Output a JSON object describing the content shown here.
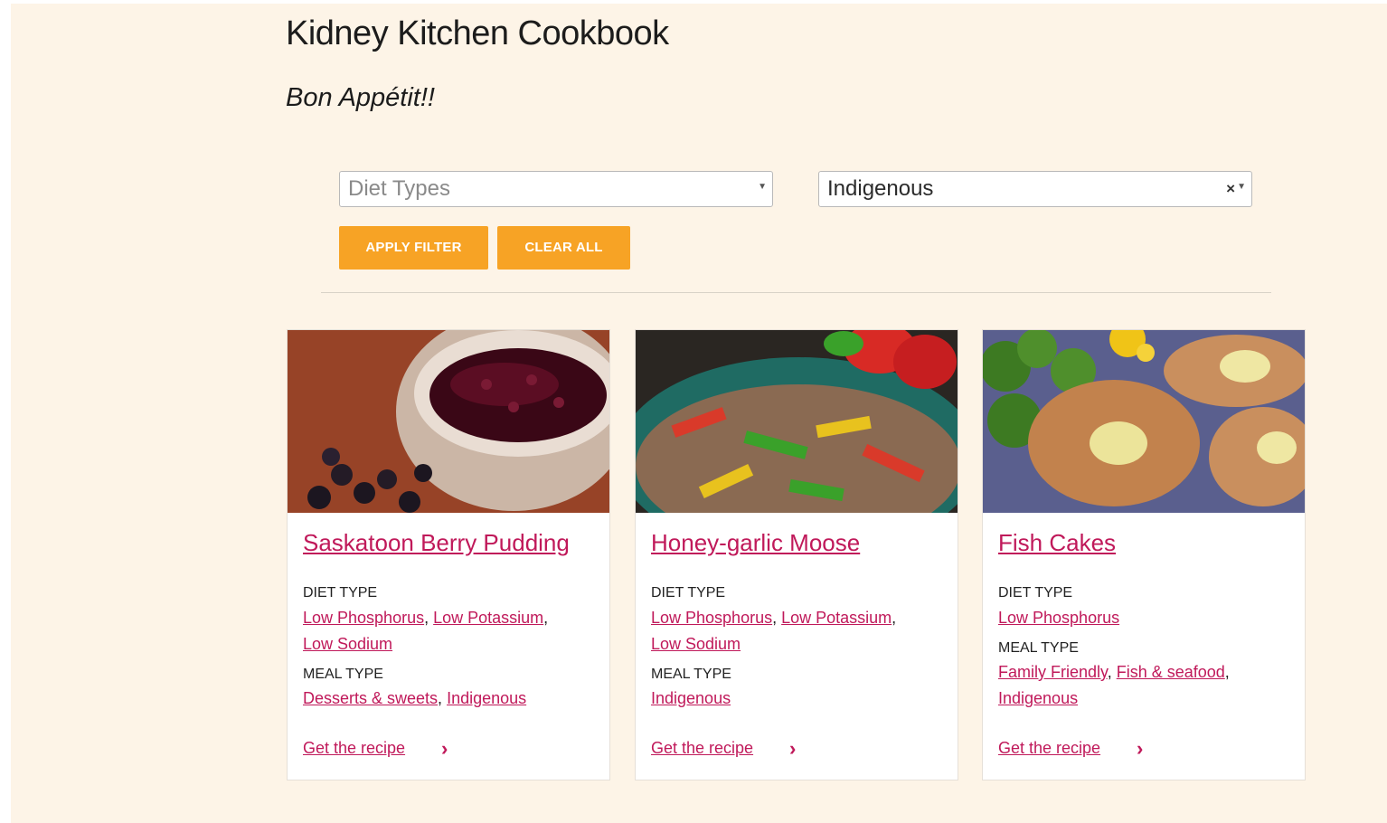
{
  "page": {
    "title": "Kidney Kitchen Cookbook",
    "subtitle": "Bon Appétit!!"
  },
  "filters": {
    "diet_placeholder": "Diet Types",
    "meal_value": "Indigenous",
    "apply_label": "APPLY FILTER",
    "clear_label": "CLEAR ALL",
    "clear_x": "×",
    "caret": "▼"
  },
  "colors": {
    "background": "#fdf4e7",
    "accent_orange": "#f7a325",
    "link_magenta": "#c0195a"
  },
  "cards": [
    {
      "name": "Saskatoon Berry Pudding",
      "image_icon": "berry-pudding-photo",
      "diet_label": "DIET TYPE",
      "diet_types": [
        "Low Phosphorus",
        "Low Potassium",
        "Low Sodium"
      ],
      "meal_label": "MEAL TYPE",
      "meal_types": [
        "Desserts & sweets",
        "Indigenous"
      ],
      "cta": "Get the recipe",
      "chevron": "›"
    },
    {
      "name": "Honey-garlic Moose",
      "image_icon": "moose-stirfry-photo",
      "diet_label": "DIET TYPE",
      "diet_types": [
        "Low Phosphorus",
        "Low Potassium",
        "Low Sodium"
      ],
      "meal_label": "MEAL TYPE",
      "meal_types": [
        "Indigenous"
      ],
      "cta": "Get the recipe",
      "chevron": "›"
    },
    {
      "name": "Fish Cakes",
      "image_icon": "fish-cakes-photo",
      "diet_label": "DIET TYPE",
      "diet_types": [
        "Low Phosphorus"
      ],
      "meal_label": "MEAL TYPE",
      "meal_types": [
        "Family Friendly",
        "Fish & seafood",
        "Indigenous"
      ],
      "cta": "Get the recipe",
      "chevron": "›"
    }
  ]
}
